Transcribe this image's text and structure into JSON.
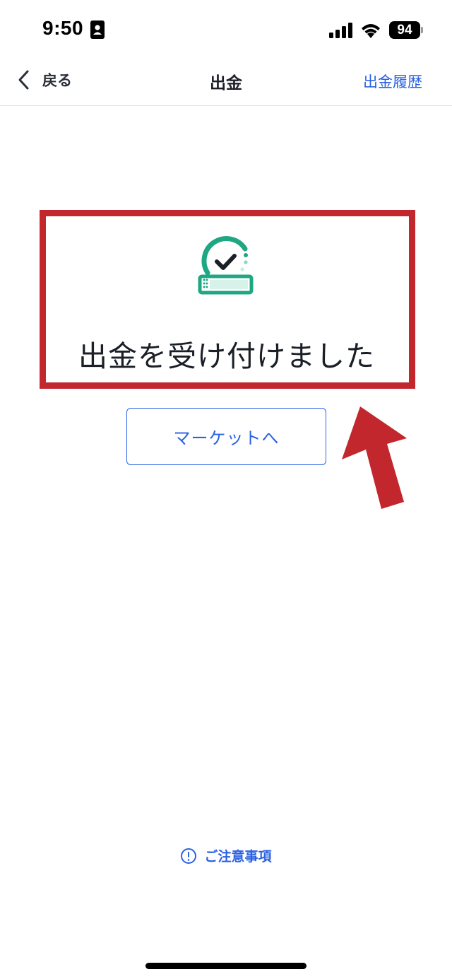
{
  "status_bar": {
    "time": "9:50",
    "battery": "94"
  },
  "nav": {
    "back_label": "戻る",
    "title": "出金",
    "history_label": "出金履歴"
  },
  "content": {
    "message": "出金を受け付けました",
    "market_button_label": "マーケットへ",
    "notes_label": "ご注意事項"
  },
  "colors": {
    "accent_blue": "#2b62e3",
    "icon_green": "#1fa783",
    "annotation_red": "#c1272d"
  },
  "icons": {
    "id_card": "id-card-icon",
    "signal": "cellular-signal-icon",
    "wifi": "wifi-icon",
    "back": "chevron-left-icon",
    "success": "check-deposit-icon",
    "notes": "info-circle-icon"
  }
}
